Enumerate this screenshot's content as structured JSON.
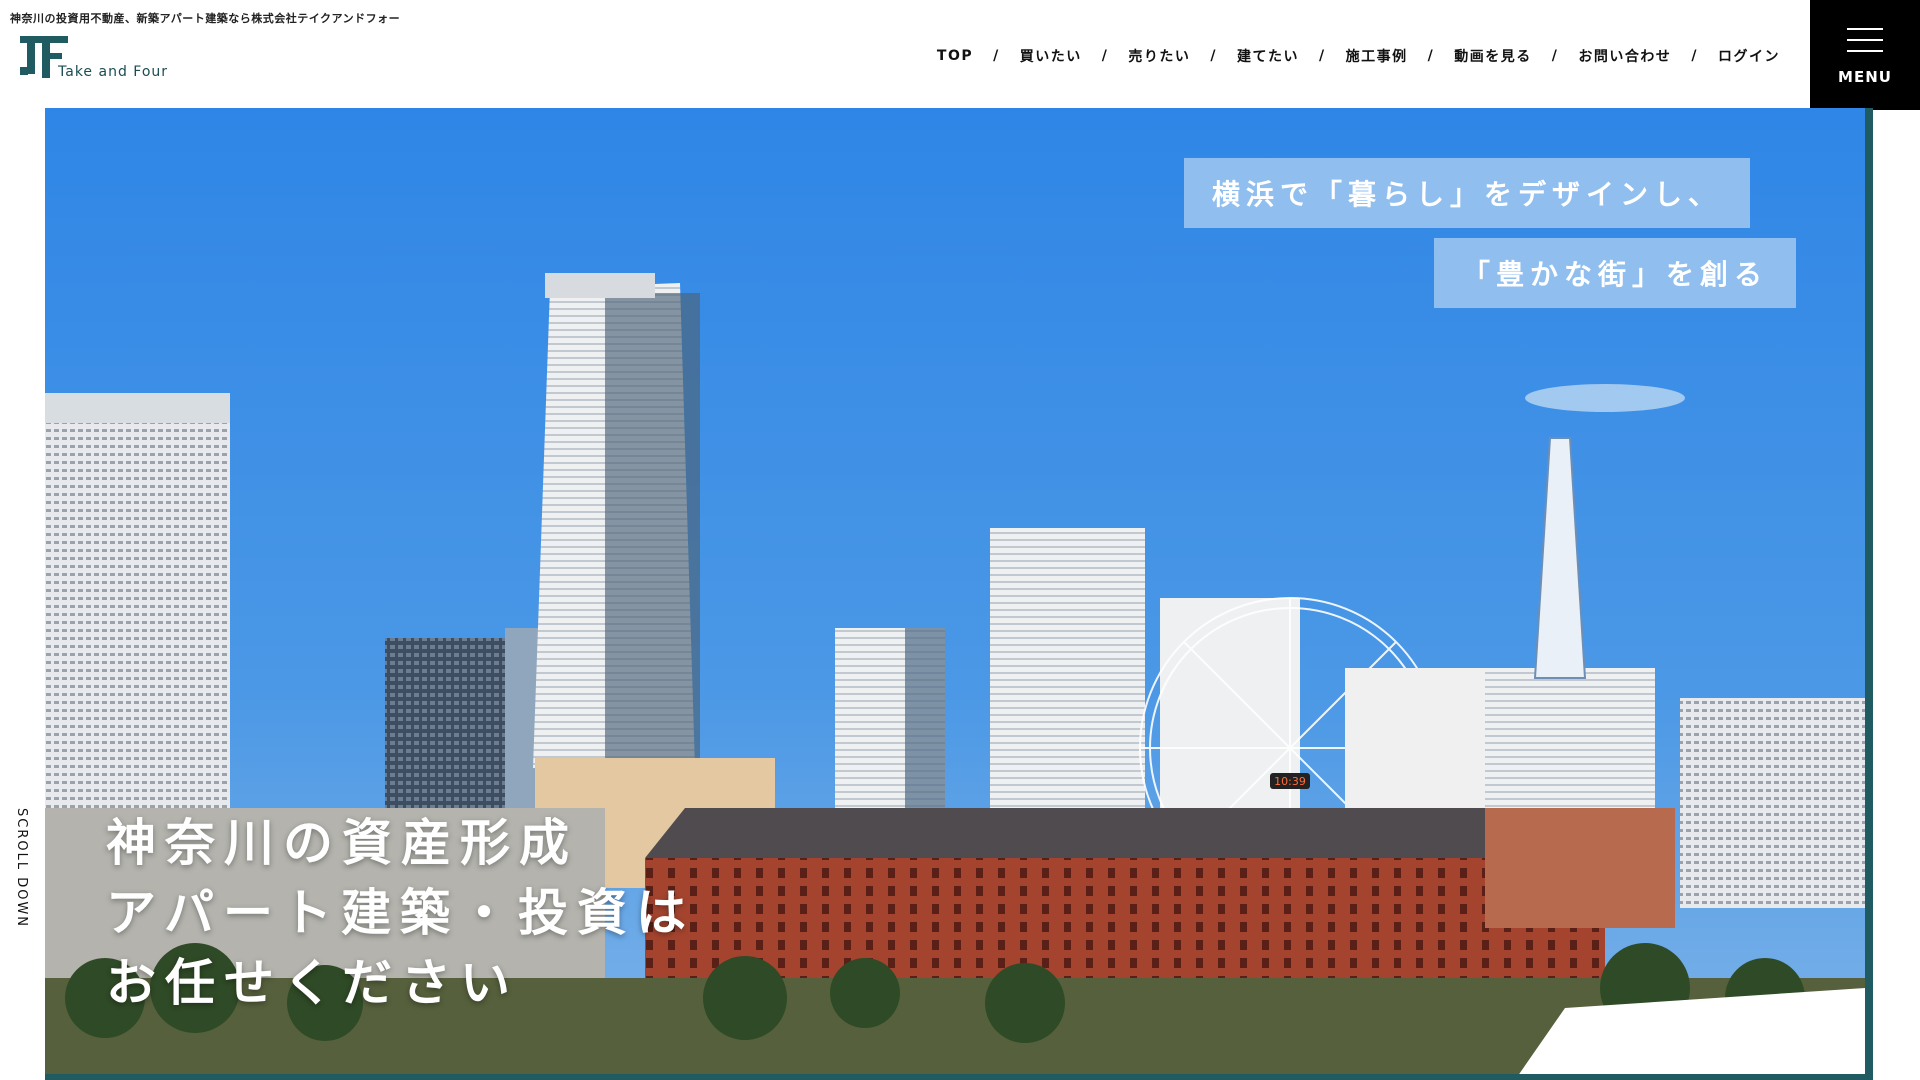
{
  "header": {
    "tagline": "神奈川の投資用不動産、新築アパート建築なら株式会社テイクアンドフォー",
    "logo_text": "Take and Four",
    "nav": [
      {
        "label": "TOP"
      },
      {
        "label": "買いたい"
      },
      {
        "label": "売りたい"
      },
      {
        "label": "建てたい"
      },
      {
        "label": "施工事例"
      },
      {
        "label": "動画を見る"
      },
      {
        "label": "お問い合わせ"
      },
      {
        "label": "ログイン"
      }
    ],
    "nav_separator": "/",
    "menu_label": "MENU"
  },
  "hero": {
    "catch_1": "横浜で「暮らし」をデザインし、",
    "catch_2": "「豊かな街」を創る",
    "copy_lines": [
      "神奈川の資産形成",
      "アパート建築・投資は",
      "お任せください"
    ],
    "ferris_display": "10:39"
  },
  "scroll_label": "SCROLL DOWN",
  "colors": {
    "brand_teal": "#1f5b60",
    "sky": "#3f8ee3",
    "catch_box": "#a0c8f0",
    "menu_bg": "#000000"
  }
}
